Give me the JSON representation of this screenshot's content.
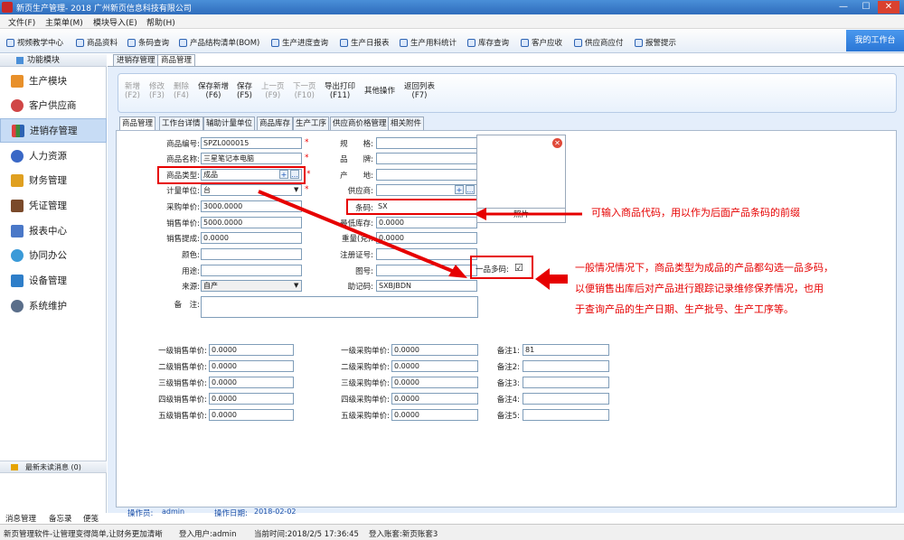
{
  "window": {
    "title": "新页生产管理- 2018 广州新页信息科技有限公司",
    "min": "—",
    "max": "☐",
    "close": "✕"
  },
  "menu": [
    "文件(F)",
    "主菜单(M)",
    "模块导入(E)",
    "帮助(H)"
  ],
  "toolbar": [
    "视频教学中心",
    "商品资料",
    "条码查询",
    "产品结构清单(BOM)",
    "生产进度查询",
    "生产日报表",
    "生产用料统计",
    "库存查询",
    "客户应收",
    "供应商应付",
    "报警提示"
  ],
  "workbench": "我的工作台",
  "sidebar": {
    "header": "功能模块",
    "items": [
      "生产模块",
      "客户供应商",
      "进销存管理",
      "人力资源",
      "财务管理",
      "凭证管理",
      "报表中心",
      "协同办公",
      "设备管理",
      "系统维护"
    ],
    "unread": "最新未读消息 (0)",
    "bottom": [
      "消息管理",
      "备忘录",
      "便笺"
    ]
  },
  "tabs": [
    "进销存管理",
    "商品管理"
  ],
  "actions": [
    {
      "l": "新增",
      "k": "(F2)"
    },
    {
      "l": "修改",
      "k": "(F3)"
    },
    {
      "l": "删除",
      "k": "(F4)"
    },
    {
      "l": "保存新增",
      "k": "(F6)"
    },
    {
      "l": "保存",
      "k": "(F5)"
    },
    {
      "l": "上一页",
      "k": "(F9)"
    },
    {
      "l": "下一页",
      "k": "(F10)"
    },
    {
      "l": "导出打印",
      "k": "(F11)"
    },
    {
      "l": "其他操作",
      "k": ""
    },
    {
      "l": "返回列表",
      "k": "(F7)"
    }
  ],
  "subtabs": [
    "商品管理",
    "工作台详情",
    "辅助计量单位",
    "商品库存",
    "生产工序",
    "供应商价格管理",
    "相关附件"
  ],
  "form": {
    "code_l": "商品编号:",
    "code": "SPZL000015",
    "name_l": "商品名称:",
    "name": "三星笔记本电脑",
    "type_l": "商品类型:",
    "type": "成品",
    "unit_l": "计量单位:",
    "unit": "台",
    "buy_l": "采购单价:",
    "buy": "3000.0000",
    "sell_l": "销售单价:",
    "sell": "5000.0000",
    "comm_l": "销售提成:",
    "comm": "0.0000",
    "color_l": "颜色:",
    "use_l": "用途:",
    "src_l": "来源:",
    "src": "自产",
    "memo_l": "备　注:",
    "spec_l": "规　　格:",
    "brand_l": "品　　牌:",
    "origin_l": "产　　地:",
    "supp_l": "供应商:",
    "bar_l": "条码:",
    "bar": "SX",
    "minstock_l": "最低库存:",
    "minstock": "0.0000",
    "weight_l": "重量(克):",
    "weight": "0.0000",
    "reg_l": "注册证号:",
    "fig_l": "图号:",
    "help_l": "助记码:",
    "help": "SXBJBDN",
    "multi_l": "一品多码:",
    "multi": "☑",
    "photo": "照片",
    "levels_sell": [
      "一级销售单价:",
      "二级销售单价:",
      "三级销售单价:",
      "四级销售单价:",
      "五级销售单价:"
    ],
    "levels_buy": [
      "一级采购单价:",
      "二级采购单价:",
      "三级采购单价:",
      "四级采购单价:",
      "五级采购单价:"
    ],
    "level_vals": [
      "0.0000",
      "0.0000",
      "0.0000",
      "0.0000",
      "0.0000"
    ],
    "remarks": [
      "备注1:",
      "备注2:",
      "备注3:",
      "备注4:",
      "备注5:"
    ],
    "remark1": "81",
    "op_l": "操作员:",
    "op": "admin",
    "date_l": "操作日期:",
    "date": "2018-02-02"
  },
  "notes": {
    "n1": "可输入商品代码，用以作为后面产品条码的前缀",
    "n2a": "一般情况情况下，商品类型为成品的产品都勾选一品多码，",
    "n2b": "以便销售出库后对产品进行跟踪记录维修保养情况，也用",
    "n2c": "于查询产品的生产日期、生产批号、生产工序等。"
  },
  "status": [
    "新页管理软件-让管理变得简单,让财务更加清晰",
    "登入用户:admin",
    "当前时间:2018/2/5 17:36:45",
    "登入账套:新页账套3"
  ],
  "colors": {
    "accent": "#2f6cbc",
    "red": "#e60000"
  }
}
